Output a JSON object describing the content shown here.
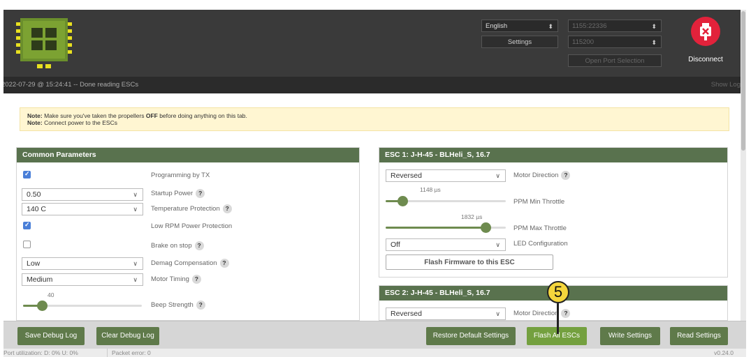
{
  "header": {
    "language": "English",
    "settings_label": "Settings",
    "port": "1155:22336",
    "baud": "115200",
    "open_port_label": "Open Port Selection",
    "disconnect_label": "Disconnect"
  },
  "log": {
    "text": "2022-07-29 @ 15:24:41 -- Done reading ESCs",
    "show_log": "Show Log"
  },
  "note": {
    "line1_prefix": "Note:",
    "line1_a": " Make sure you've taken the propellers ",
    "line1_b": "OFF",
    "line1_c": " before doing anything on this tab.",
    "line2_prefix": "Note:",
    "line2_text": " Connect power to the ESCs"
  },
  "common": {
    "title": "Common Parameters",
    "programming_by_tx": "Programming by TX",
    "startup_power_value": "0.50",
    "startup_power": "Startup Power",
    "temp_protection_value": "140 C",
    "temp_protection": "Temperature Protection",
    "low_rpm": "Low RPM Power Protection",
    "brake_on_stop": "Brake on stop",
    "demag_value": "Low",
    "demag": "Demag Compensation",
    "timing_value": "Medium",
    "timing": "Motor Timing",
    "beep_value": "40",
    "beep_level": 0.16,
    "beep": "Beep Strength",
    "help_glyph": "?"
  },
  "esc1": {
    "title": "ESC 1: J-H-45 - BLHeli_S, 16.7",
    "direction_value": "Reversed",
    "direction": "Motor Direction",
    "min_throttle_value": "1148 µs",
    "min_level": 0.14,
    "min_throttle": "PPM Min Throttle",
    "max_throttle_value": "1832 µs",
    "max_level": 0.83,
    "max_throttle": "PPM Max Throttle",
    "led_value": "Off",
    "led": "LED Configuration",
    "flash_label": "Flash Firmware to this ESC"
  },
  "esc2": {
    "title": "ESC 2: J-H-45 - BLHeli_S, 16.7",
    "direction_value": "Reversed",
    "direction": "Motor Direction"
  },
  "buttons": {
    "save_debug": "Save Debug Log",
    "clear_debug": "Clear Debug Log",
    "restore": "Restore Default Settings",
    "flash_all": "Flash All ESCs",
    "write": "Write Settings",
    "read": "Read Settings"
  },
  "status": {
    "port_util": "Port utilization: D: 0% U: 0%",
    "packet_error": "Packet error: 0",
    "version": "v0.24.0"
  },
  "annotation": {
    "number": "5"
  },
  "colors": {
    "accent_green": "#59724e",
    "disconnect_red": "#e2223b",
    "marker_yellow": "#f5d63c"
  }
}
